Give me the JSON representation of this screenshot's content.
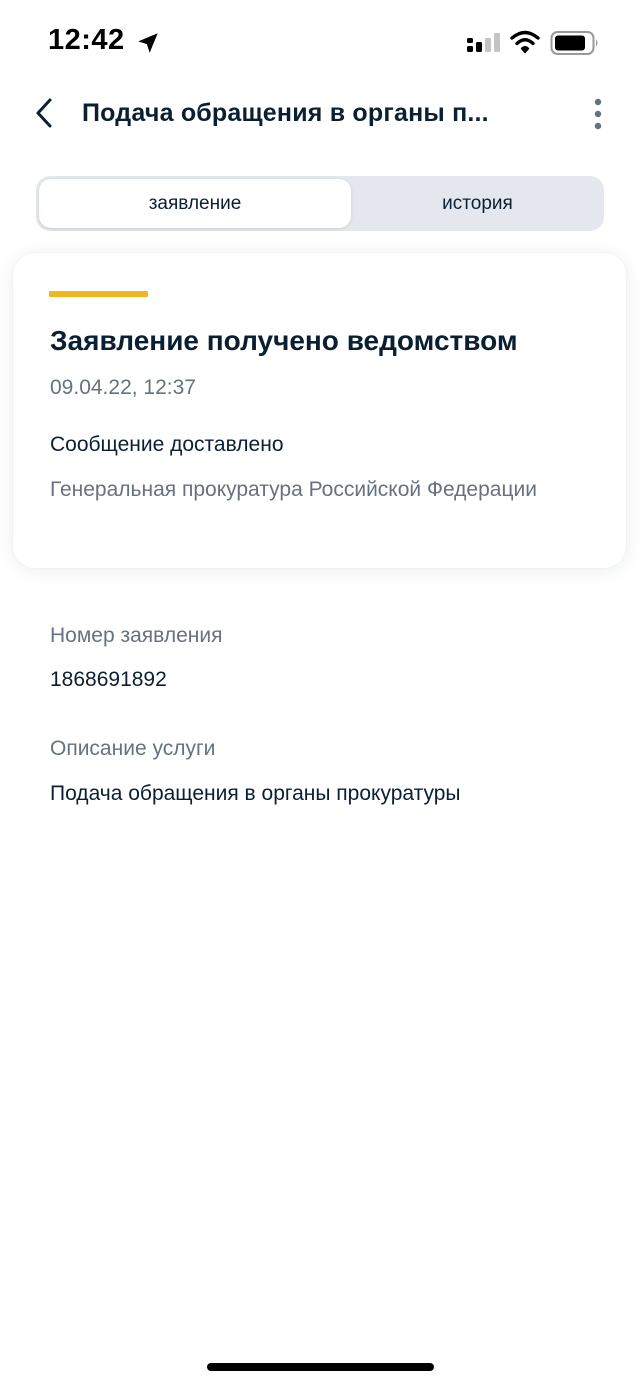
{
  "status_bar": {
    "time": "12:42"
  },
  "nav": {
    "title": "Подача обращения в органы п..."
  },
  "tabs": [
    {
      "label": "заявление",
      "active": true
    },
    {
      "label": "история",
      "active": false
    }
  ],
  "status_card": {
    "title": "Заявление получено ведомством",
    "date": "09.04.22, 12:37",
    "message": "Сообщение доставлено",
    "agency": "Генеральная прокуратура Российской Федерации",
    "accent_color": "#f0b620"
  },
  "details": {
    "number_label": "Номер заявления",
    "number_value": "1868691892",
    "description_label": "Описание услуги",
    "description_value": "Подача обращения в органы прокуратуры"
  },
  "icons": {
    "back": "chevron-left-icon",
    "more": "more-vertical-icon",
    "location": "location-arrow-icon",
    "signal": "cellular-signal-icon",
    "wifi": "wifi-icon",
    "battery": "battery-icon"
  },
  "colors": {
    "primary_text": "#0b1f33",
    "secondary_text": "#66727f",
    "segment_bg": "#e4e8ee"
  }
}
